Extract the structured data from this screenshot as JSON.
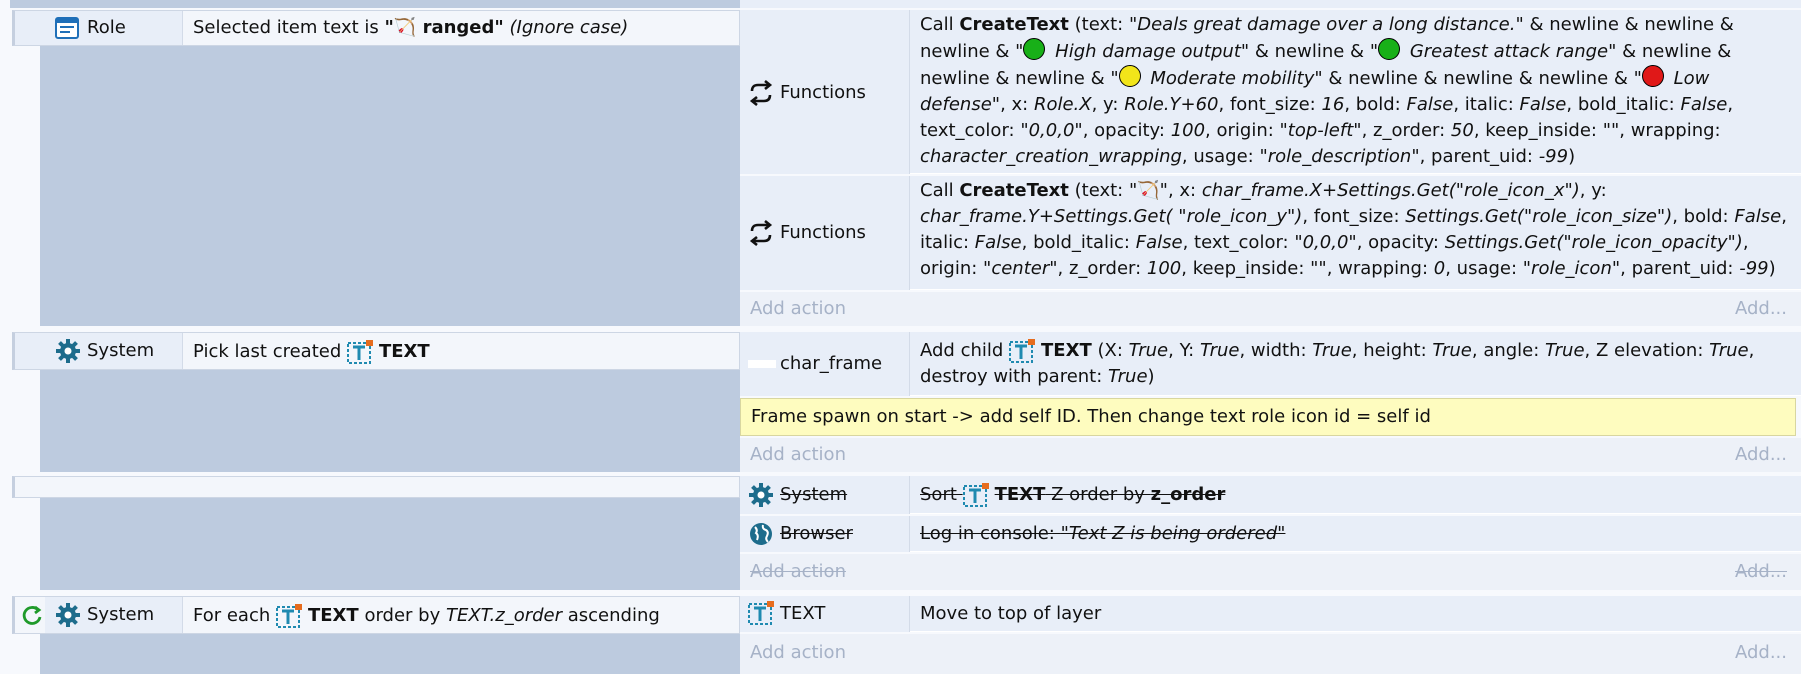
{
  "symbols": {
    "ranged": "🏹",
    "green": "#18b018",
    "yellow": "#f2e51a",
    "red": "#e01818",
    "text_icon": "text-object-icon",
    "gear": "gear-icon",
    "loop": "loop-icon"
  },
  "events": {
    "ev1": {
      "object": "Role",
      "condition_pre": "Selected item text is ",
      "condition_quote_open": "\"",
      "condition_value": " ranged\"",
      "condition_suffix": " (Ignore case)",
      "action1": {
        "object": "Functions",
        "call": "Call ",
        "fn": "CreateText",
        "t1": " (text: ",
        "q1": "\"Deals great damage over a long distance.\"",
        "t2": " & newline & newline & newline & \"",
        "q2": " High damage output\"",
        "t3": " & newline & \"",
        "q3": " Greatest attack range\"",
        "t4": " & newline & newline & newline & \"",
        "q4": " Moderate mobility\"",
        "t5": " & newline & newline & newline & \"",
        "q5": " Low defense\"",
        "t6": ", x: ",
        "x": "Role.X",
        "t7": ", y: ",
        "y": "Role.Y+60",
        "t8": ", font_size: ",
        "fs": "16",
        "t9": ", bold: ",
        "bold": "False",
        "t10": ", italic: ",
        "italic": "False",
        "t11": ", bold_italic: ",
        "bi": "False",
        "t12": ", text_color: ",
        "color": "\"0,0,0\"",
        "t13": ", opacity: ",
        "op": "100",
        "t14": ", origin: ",
        "origin": "\"top-left\"",
        "t15": ", z_order: ",
        "z": "50",
        "t16": ", keep_inside: ",
        "keep": "\"\"",
        "t17": ", wrapping: ",
        "wrap": "character_creation_wrapping",
        "t18": ", usage: ",
        "usage": "\"role_description\"",
        "t19": ", parent_uid: ",
        "puid": "-99",
        "t20": ")"
      },
      "action2": {
        "object": "Functions",
        "call": "Call ",
        "fn": "CreateText",
        "t1": " (text: ",
        "q1a": "\"",
        "q1b": "\"",
        "t2": ", x: ",
        "x": "char_frame.X+Settings.Get(\"role_icon_x\")",
        "t3": ", y: ",
        "y": "char_frame.Y+Settings.Get( \"role_icon_y\")",
        "t4": ", font_size: ",
        "fs": "Settings.Get(\"role_icon_size\")",
        "t5": ", bold: ",
        "bold": "False",
        "t6": ", italic: ",
        "italic": "False",
        "t7": ", bold_italic: ",
        "bi": "False",
        "t8": ", text_color: ",
        "color": "\"0,0,0\"",
        "t9": ", opacity: ",
        "op": "Settings.Get(\"role_icon_opacity\")",
        "t10": ", origin: ",
        "origin": "\"center\"",
        "t11": ", z_order: ",
        "z": "100",
        "t12": ", keep_inside: ",
        "keep": "\"\"",
        "t13": ", wrapping: ",
        "wrap": "0",
        "t14": ", usage: ",
        "usage": "\"role_icon\"",
        "t15": ", parent_uid: ",
        "puid": "-99",
        "t16": ")"
      },
      "add_action": "Add action",
      "add_right": "Add..."
    },
    "ev2": {
      "object": "System",
      "condition_pre": "Pick last created ",
      "condition_obj": "TEXT",
      "action1": {
        "object": "char_frame",
        "pre": "Add child ",
        "obj": "TEXT",
        "t1": " (X: ",
        "x": "True",
        "t2": ", Y: ",
        "y": "True",
        "t3": ", width: ",
        "w": "True",
        "t4": ", height: ",
        "h": "True",
        "t5": ", angle: ",
        "a": "True",
        "t6": ", Z elevation: ",
        "ze": "True",
        "t7": ", destroy with parent: ",
        "d": "True",
        "t8": ")"
      },
      "comment": "Frame spawn on start -> add self ID. Then change text role icon id = self id",
      "add_action": "Add action",
      "add_right": "Add..."
    },
    "ev3": {
      "action1": {
        "object": "System",
        "pre": "Sort ",
        "obj": "TEXT",
        "mid": " Z order by ",
        "by": "z_order"
      },
      "action2": {
        "object": "Browser",
        "pre": "Log in console: ",
        "msg": "\"Text Z is being ordered\""
      },
      "add_action": "Add action",
      "add_right": "Add..."
    },
    "ev4": {
      "object": "System",
      "condition_pre": "For each ",
      "condition_obj": "TEXT",
      "condition_mid": " order by ",
      "condition_expr": "TEXT.z_order",
      "condition_suffix": " ascending",
      "action1": {
        "object": "TEXT",
        "text": "Move to top of layer"
      },
      "add_action": "Add action",
      "add_right": "Add..."
    }
  }
}
